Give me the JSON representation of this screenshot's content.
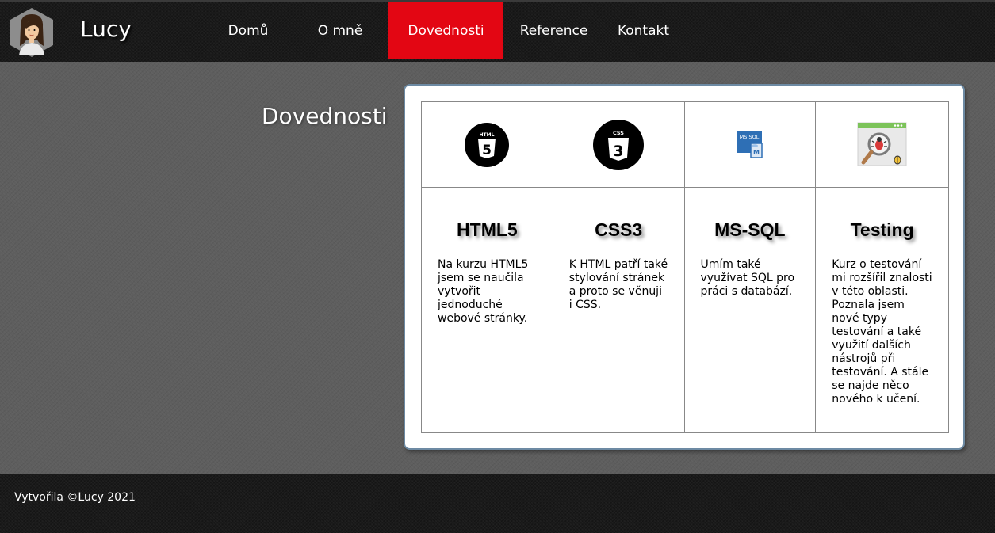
{
  "header": {
    "brand": "Lucy",
    "nav": [
      {
        "label": "Domů",
        "active": false
      },
      {
        "label": "O mně",
        "active": false
      },
      {
        "label": "Dovednosti",
        "active": true
      },
      {
        "label": "Reference",
        "active": false
      },
      {
        "label": "Kontakt",
        "active": false
      }
    ]
  },
  "main": {
    "heading": "Dovednosti",
    "skills": [
      {
        "title": "HTML5",
        "icon": "html5-icon",
        "icon_text": "HTML",
        "text": "Na kurzu HTML5 jsem se naučila vytvořit jednoduché webové stránky."
      },
      {
        "title": "CSS3",
        "icon": "css3-icon",
        "icon_text": "CSS",
        "text": "K HTML patří také stylování stránek a proto se věnuji i CSS."
      },
      {
        "title": "MS-SQL",
        "icon": "ms-sql-icon",
        "icon_text": "MS SQL",
        "text": "Umím také využívat SQL pro práci s databází."
      },
      {
        "title": "Testing",
        "icon": "testing-bug-icon",
        "text": "Kurz o testování mi rozšířil znalosti v této oblasti. Poznala jsem nové typy testování a také využití dalších nástrojů při testování. A stále se najde něco nového k učení."
      }
    ]
  },
  "footer": {
    "text": "Vytvořila ©Lucy 2021"
  },
  "colors": {
    "accent": "#e30613",
    "header_bg": "#1a1a1a",
    "page_bg": "#5e5e5e"
  }
}
